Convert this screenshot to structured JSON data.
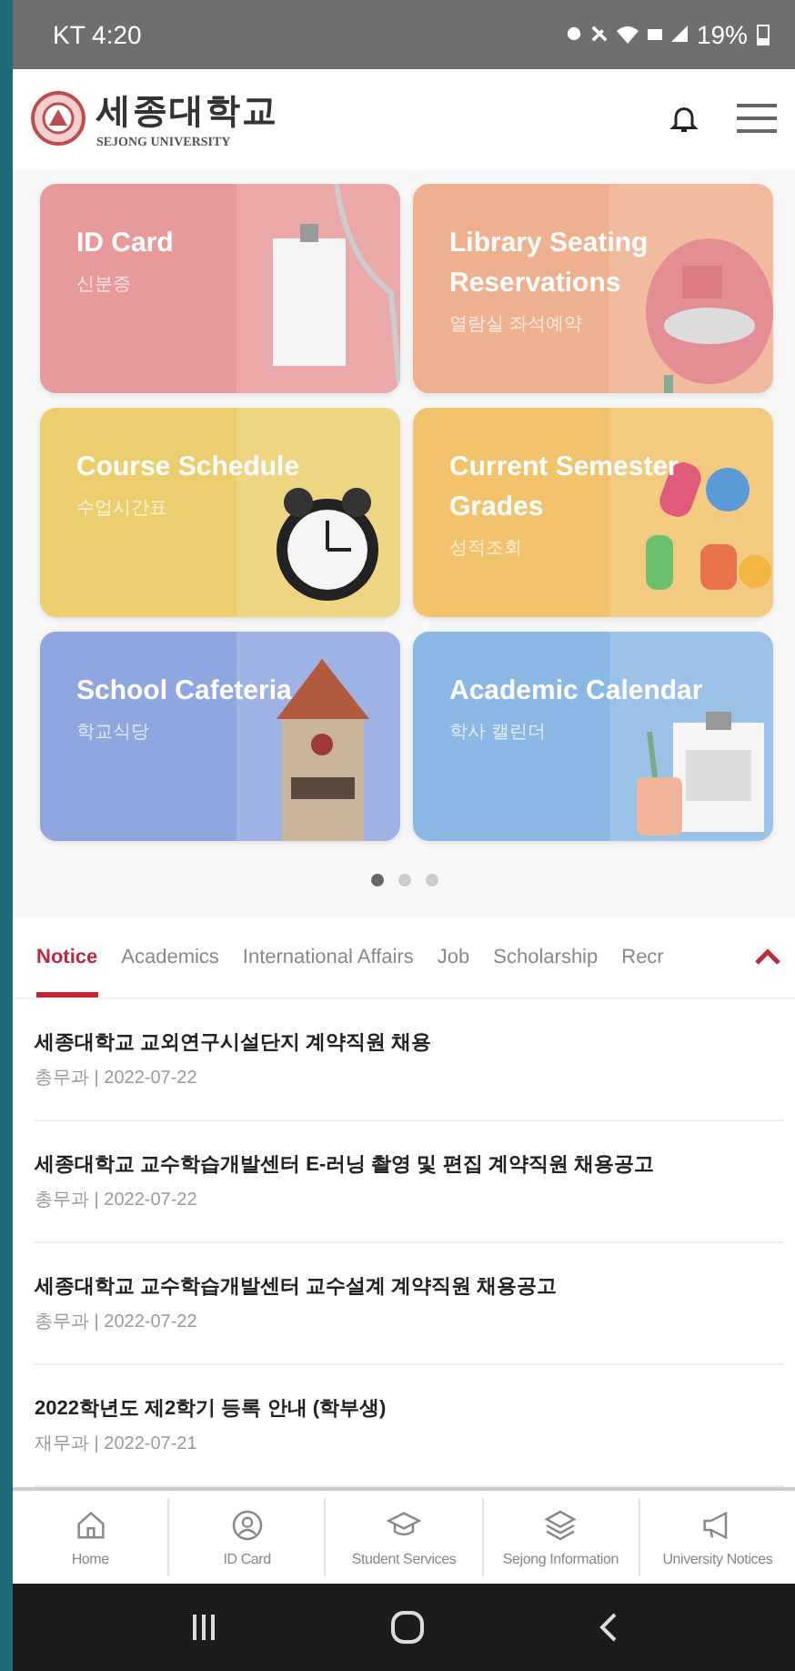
{
  "status_bar": {
    "carrier_time": "KT 4:20",
    "battery": "19%"
  },
  "header": {
    "logo_title": "세종대학교",
    "logo_subtitle": "SEJONG UNIVERSITY"
  },
  "cards": [
    {
      "title": "ID Card",
      "subtitle": "신분증",
      "color": "#e89a9a",
      "kind": "picture"
    },
    {
      "title": "Library Seating Reservations",
      "subtitle": "열람실 좌석예약",
      "color": "#eeb08e",
      "kind": "picture"
    },
    {
      "title": "Course Schedule",
      "subtitle": "수업시간표",
      "color": "#ecce6e",
      "kind": "picture"
    },
    {
      "title": "Current Semester Grades",
      "subtitle": "성적조회",
      "color": "#f0c36c",
      "kind": "picture"
    },
    {
      "title": "School Cafeteria",
      "subtitle": "학교식당",
      "color": "#8fa6e0",
      "kind": "picture"
    },
    {
      "title": "Academic Calendar",
      "subtitle": "학사 캘린더",
      "color": "#8bb7e4",
      "kind": "picture"
    }
  ],
  "pager": [
    {
      "selected": true
    },
    {
      "selected": false
    },
    {
      "selected": false
    }
  ],
  "tabs": [
    {
      "label": "Notice",
      "selected": true
    },
    {
      "label": "Academics",
      "selected": false
    },
    {
      "label": "International Affairs",
      "selected": false
    },
    {
      "label": "Job",
      "selected": false
    },
    {
      "label": "Scholarship",
      "selected": false
    },
    {
      "label": "Recr",
      "selected": false
    }
  ],
  "notices": [
    {
      "title": "세종대학교 교외연구시설단지 계약직원 채용",
      "meta": "총무과 | 2022-07-22"
    },
    {
      "title": "세종대학교 교수학습개발센터 E-러닝 촬영 및 편집 계약직원 채용공고",
      "meta": "총무과 | 2022-07-22"
    },
    {
      "title": "세종대학교 교수학습개발센터 교수설계 계약직원 채용공고",
      "meta": "총무과 | 2022-07-22"
    },
    {
      "title": "2022학년도 제2학기 등록 안내 (학부생)",
      "meta": "재무과 | 2022-07-21"
    }
  ],
  "bottom_nav": [
    {
      "label": "Home",
      "kind": "home"
    },
    {
      "label": "ID Card",
      "kind": "person"
    },
    {
      "label": "Student Services",
      "kind": "cap"
    },
    {
      "label": "Sejong Information",
      "kind": "layers"
    },
    {
      "label": "University Notices",
      "kind": "megaphone"
    }
  ]
}
